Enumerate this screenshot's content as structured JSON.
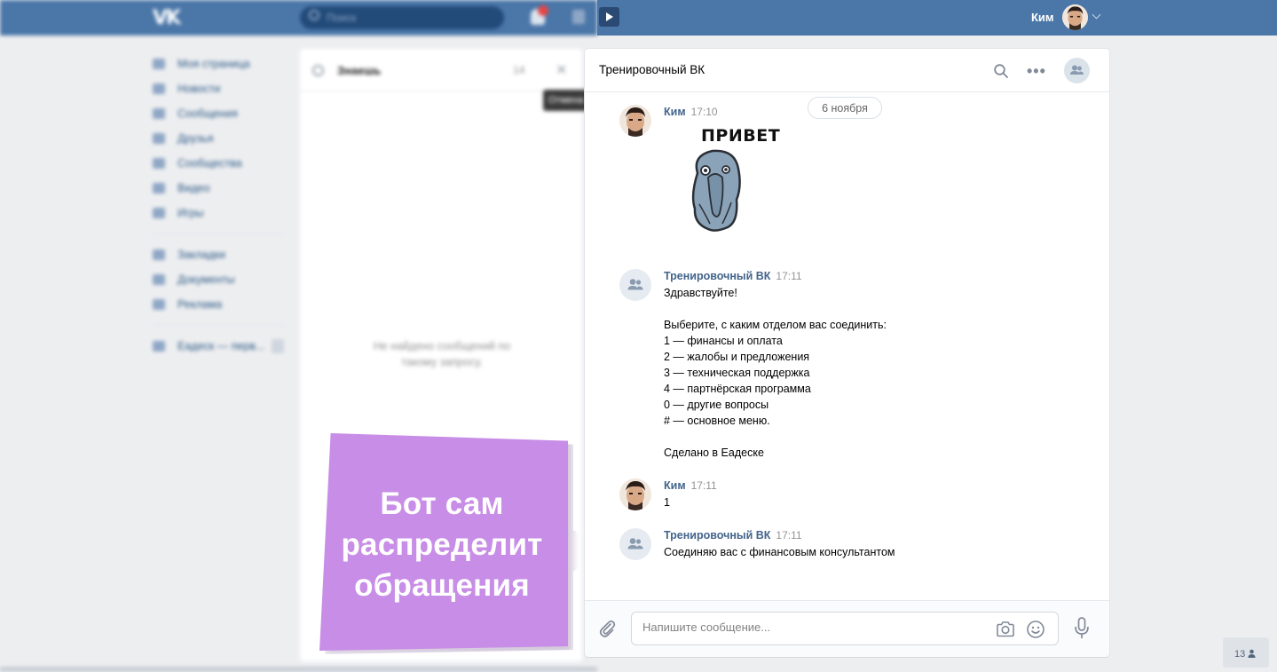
{
  "background_page": {
    "search_placeholder": "Поиск",
    "nav_items": [
      "Моя страница",
      "Новости",
      "Сообщения",
      "Друзья",
      "Сообщества",
      "Видео",
      "Игры"
    ],
    "nav_items_2": [
      "Закладки",
      "Документы",
      "Реклама"
    ],
    "nav_item_3": "Еадеск — перв...",
    "panel_search_value": "Знаешь",
    "panel_count": "14",
    "empty_text": "Не найдено сообщений по\nтакому запросу.",
    "tooltip": "Отмена"
  },
  "header": {
    "user_name": "Ким"
  },
  "chat": {
    "title": "Тренировочный ВК",
    "date_divider": "6 ноября",
    "messages": [
      {
        "author": "Ким",
        "time": "17:10",
        "type": "sticker",
        "sticker_text": "ПРИВЕТ"
      },
      {
        "author": "Тренировочный ВК",
        "time": "17:11",
        "text": "Здравствуйте!\n\nВыберите, с каким отделом вас соединить:\n1 — финансы и оплата\n2 — жалобы и предложения\n3 — техническая поддержка\n4 — партнёрская программа\n0 — другие вопросы\n# — основное меню.\n\nСделано в Еадеске"
      },
      {
        "author": "Ким",
        "time": "17:11",
        "text": "1"
      },
      {
        "author": "Тренировочный ВК",
        "time": "17:11",
        "text": "Соединяю вас с финансовым консультантом"
      }
    ],
    "composer_placeholder": "Напишите сообщение..."
  },
  "corner_badge": "13",
  "callout": {
    "line1": "Бот сам",
    "line2": "распределит",
    "line3": "обращения",
    "color": "#c88de6"
  },
  "colors": {
    "vk_blue": "#4a76a8",
    "link": "#42648b"
  }
}
